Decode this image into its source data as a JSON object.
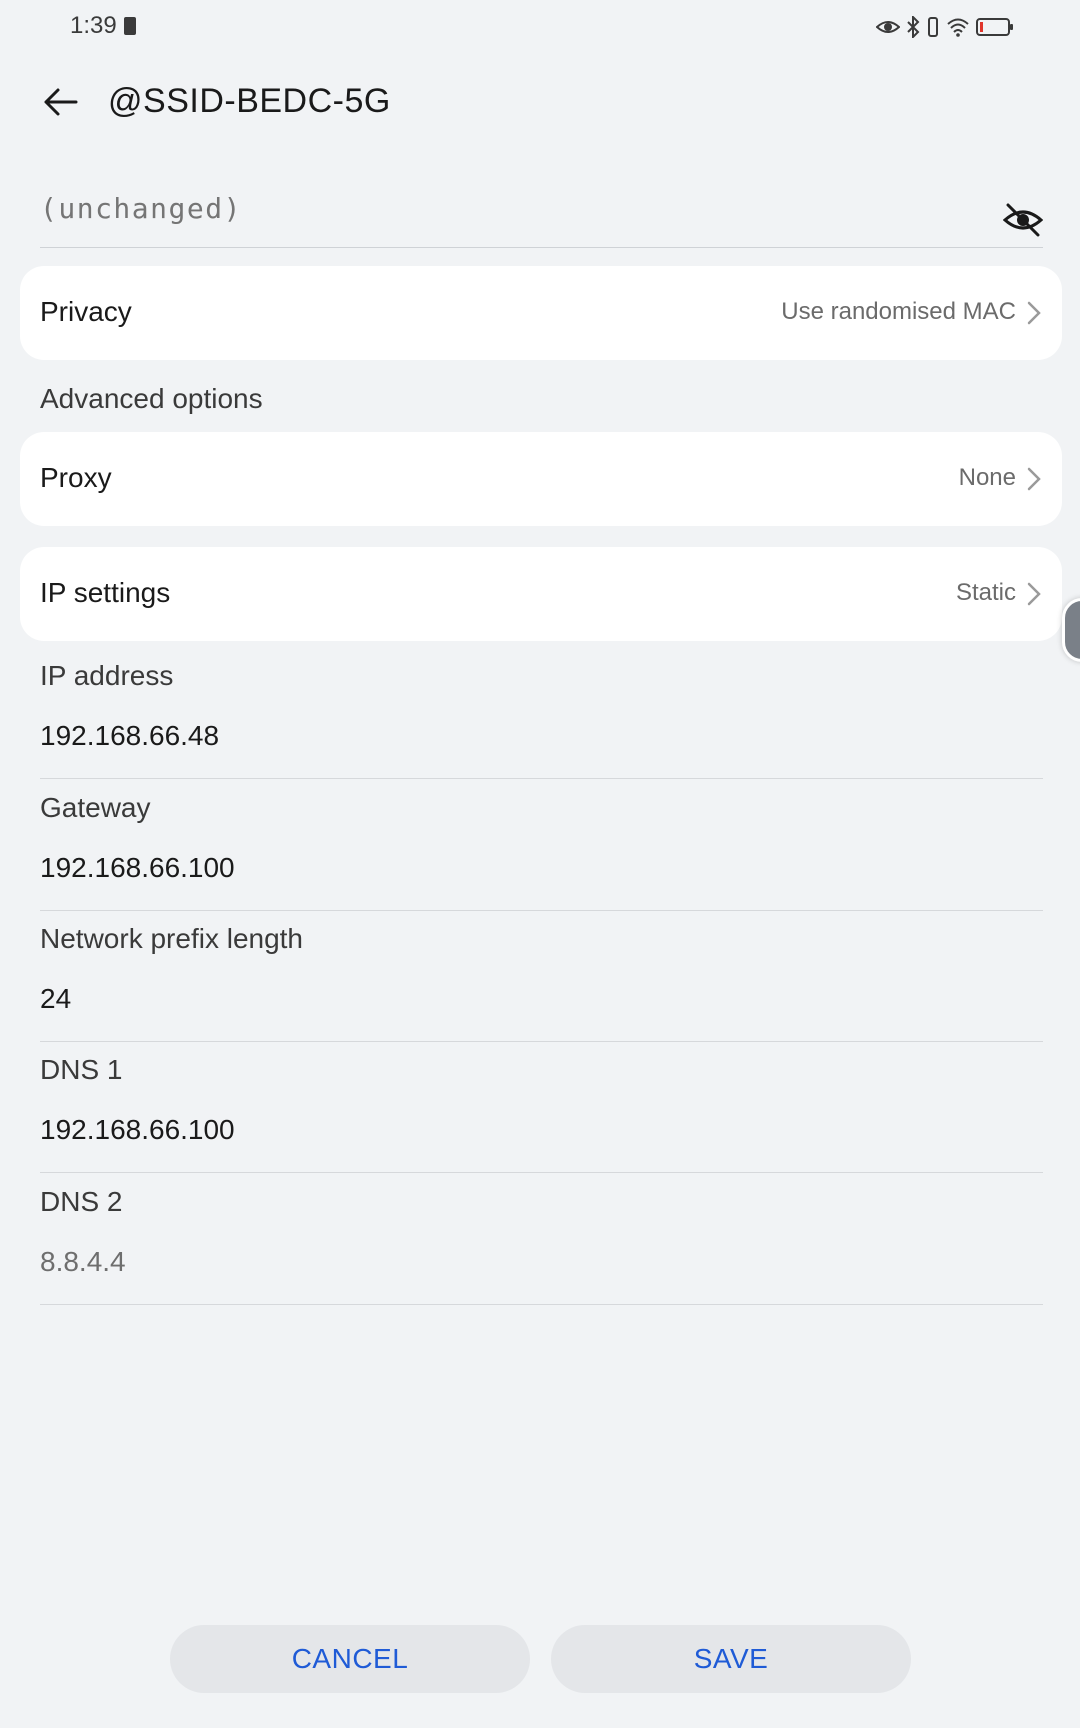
{
  "status_bar": {
    "time": "1:39",
    "battery_color": "#e0352b"
  },
  "header": {
    "title": "@SSID-BEDC-5G"
  },
  "password": {
    "placeholder": "(unchanged)",
    "value": ""
  },
  "privacy": {
    "label": "Privacy",
    "value": "Use randomised MAC"
  },
  "advanced": {
    "label": "Advanced options"
  },
  "proxy": {
    "label": "Proxy",
    "value": "None"
  },
  "ip_settings": {
    "label": "IP settings",
    "value": "Static"
  },
  "fields": {
    "ip_address": {
      "label": "IP address",
      "value": "192.168.66.48"
    },
    "gateway": {
      "label": "Gateway",
      "value": "192.168.66.100"
    },
    "prefix": {
      "label": "Network prefix length",
      "value": "24"
    },
    "dns1": {
      "label": "DNS 1",
      "value": "192.168.66.100"
    },
    "dns2": {
      "label": "DNS 2",
      "placeholder": "8.8.4.4"
    }
  },
  "buttons": {
    "cancel": "CANCEL",
    "save": "SAVE"
  },
  "accent_color": "#1f5bd6"
}
